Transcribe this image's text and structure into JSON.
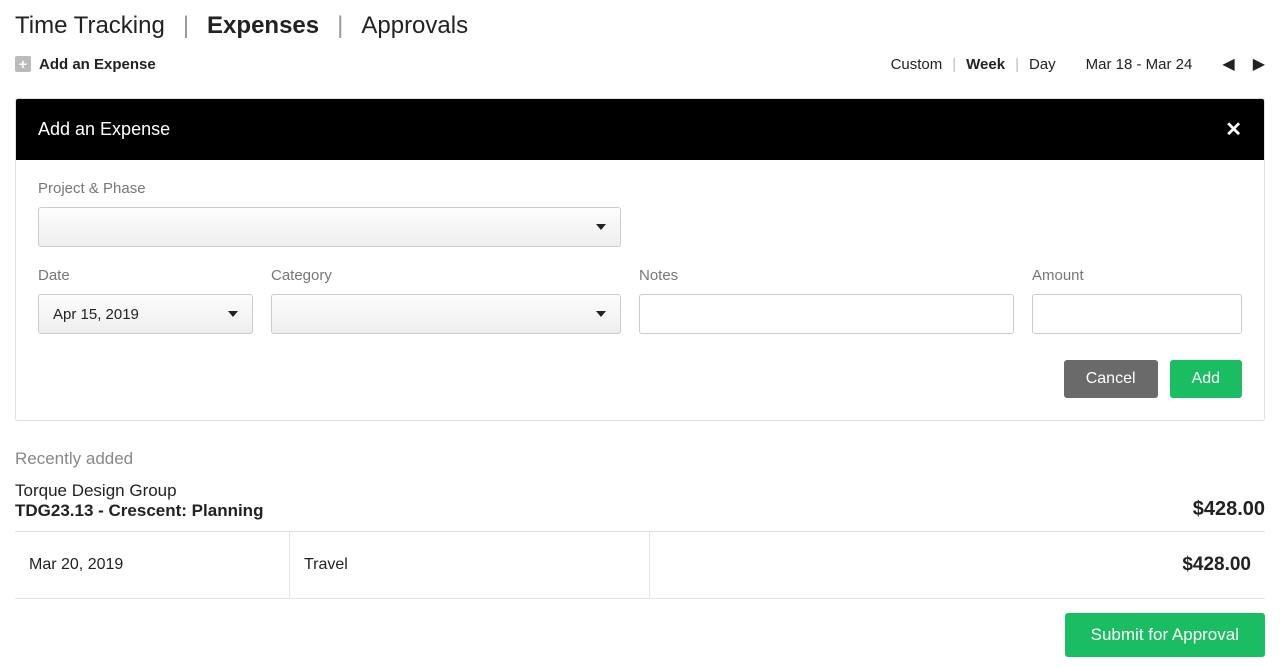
{
  "tabs": {
    "time_tracking": "Time Tracking",
    "expenses": "Expenses",
    "approvals": "Approvals"
  },
  "toolbar": {
    "add_expense": "Add an Expense",
    "view": {
      "custom": "Custom",
      "week": "Week",
      "day": "Day"
    },
    "date_range": "Mar 18 - Mar 24"
  },
  "panel": {
    "title": "Add an Expense",
    "labels": {
      "project_phase": "Project & Phase",
      "date": "Date",
      "category": "Category",
      "notes": "Notes",
      "amount": "Amount"
    },
    "values": {
      "project_phase": "",
      "date": "Apr 15, 2019",
      "category": "",
      "notes": "",
      "amount": ""
    },
    "buttons": {
      "cancel": "Cancel",
      "add": "Add"
    }
  },
  "recent": {
    "heading": "Recently added",
    "client": "Torque Design Group",
    "project": "TDG23.13 - Crescent: Planning",
    "total": "$428.00",
    "items": [
      {
        "date": "Mar 20, 2019",
        "category": "Travel",
        "amount": "$428.00"
      }
    ]
  },
  "footer": {
    "submit": "Submit for Approval"
  }
}
